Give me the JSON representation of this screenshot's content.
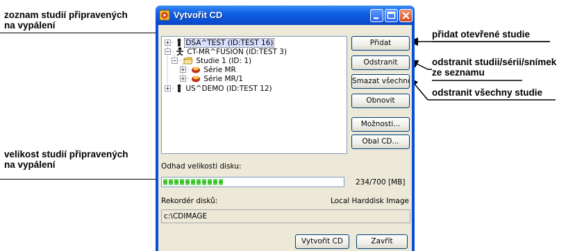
{
  "callouts": {
    "studies_ready_line1": "zoznam studií připravených",
    "studies_ready_line2": "na vypálení",
    "size_line1": "velikost studií připravených",
    "size_line2": "na vypálení",
    "add_open": "přidat otevřené studie",
    "remove_line1": "odstranit studii/sérii/snímek",
    "remove_line2": "ze seznamu",
    "remove_all": "odstranit všechny studie"
  },
  "window": {
    "title": "Vytvořit CD"
  },
  "tree": {
    "items": [
      {
        "label": "DSA^TEST (ID:TEST 16)",
        "icon": "person-icon"
      },
      {
        "label": "CT-MR^FUSION (ID:TEST 3)",
        "icon": "person-icon"
      },
      {
        "label": "Studie 1 (ID: 1)",
        "icon": "folder-icon"
      },
      {
        "label": "Série MR",
        "icon": "series-icon"
      },
      {
        "label": "Série MR/1",
        "icon": "series-icon"
      },
      {
        "label": "US^DEMO (ID:TEST 12)",
        "icon": "person-icon"
      }
    ]
  },
  "buttons": {
    "add": "Přidat",
    "remove": "Odstranit",
    "remove_all": "Smazat všechno",
    "refresh": "Obnovit",
    "options": "Možnosti...",
    "cover": "Obal CD...",
    "create": "Vytvořit CD",
    "close": "Zavřít"
  },
  "disk": {
    "estimate_label": "Odhad velikosti disku:",
    "size_text": "234/700 [MB]",
    "progress_fraction": 0.334
  },
  "recorder": {
    "label": "Rekordér disků:",
    "value": "Local Harddisk Image",
    "path": "c:\\CDIMAGE"
  },
  "colors": {
    "titlebar": "#0a50d4",
    "progress": "#28b814",
    "client": "#ece9d8"
  }
}
